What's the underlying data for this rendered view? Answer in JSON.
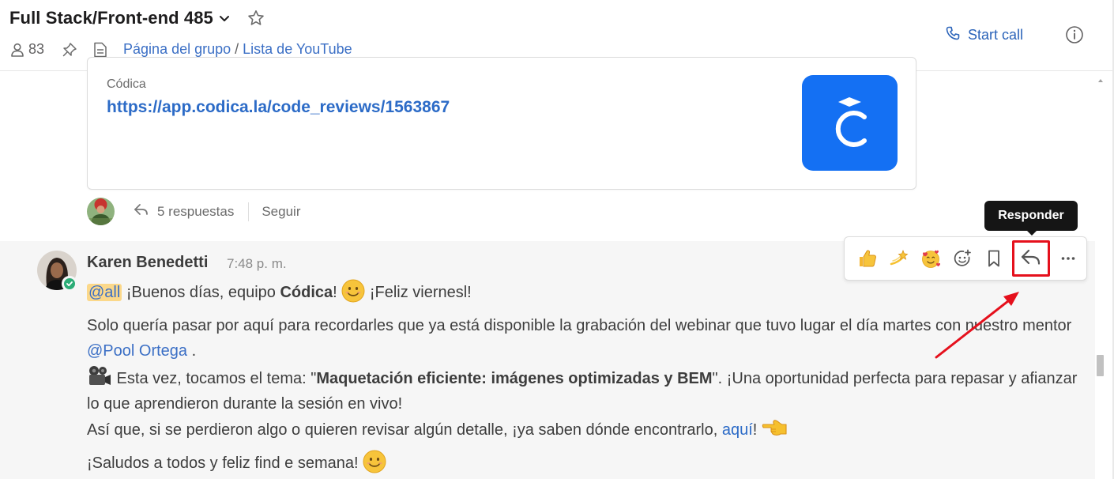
{
  "header": {
    "title": "Full Stack/Front-end 485",
    "member_count": "83",
    "links": [
      "Página del grupo",
      "Lista de YouTube"
    ],
    "link_separator": "/",
    "start_call": "Start call"
  },
  "card": {
    "site": "Códica",
    "url": "https://app.codica.la/code_reviews/1563867",
    "logo_color": "#1470f3"
  },
  "thread": {
    "replies": "5 respuestas",
    "follow": "Seguir"
  },
  "message": {
    "author": "Karen Benedetti",
    "time": "7:48 p. m.",
    "mention_all": "@all",
    "l1_a": " ¡Buenos días, equipo ",
    "l1_bold": "Códica",
    "l1_b": "! ",
    "l1_c": " ¡Feliz viernesl!",
    "p2_a": "Solo quería pasar por aquí para recordarles que ya está disponible la grabación del webinar que tuvo lugar el día martes con nuestro mentor ",
    "p2_mention": "@Pool Ortega",
    "p2_b": " .",
    "p3_a": " Esta vez, tocamos el tema: \"",
    "p3_bold": "Maquetación eficiente: imágenes optimizadas y BEM",
    "p3_b": "\". ¡Una oportunidad perfecta para repasar y afianzar lo que aprendieron durante la sesión en vivo!",
    "p4_a": "Así que, si se perdieron algo o quieren revisar algún detalle, ¡ya saben dónde encontrarlo, ",
    "p4_link": "aquí",
    "p4_b": "! ",
    "p5": "¡Saludos a todos y feliz find e semana! "
  },
  "toolbar": {
    "tooltip": "Responder",
    "icons": [
      "thumbs-up-icon",
      "dizzy-icon",
      "smiling-face-hearts-icon",
      "add-reaction-icon",
      "bookmark-icon",
      "reply-icon",
      "more-icon"
    ]
  },
  "colors": {
    "link": "#2c6bc7",
    "highlight": "#e5101c",
    "mention_bg": "#fbd88a",
    "presence": "#2bac76"
  }
}
